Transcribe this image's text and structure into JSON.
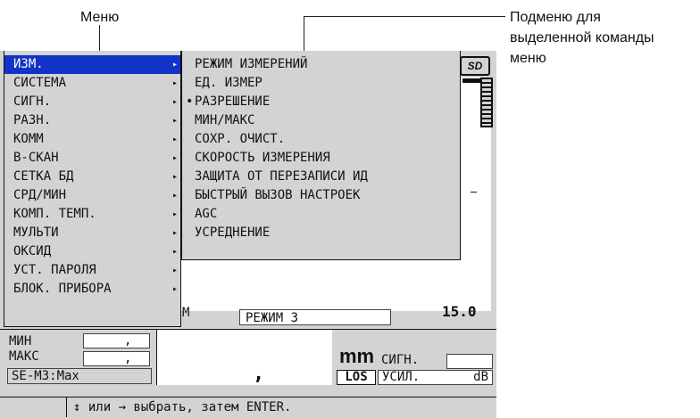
{
  "annotations": {
    "menu_label": "Меню",
    "submenu_label_lines": [
      "Подменю для",
      "выделенной команды",
      "меню"
    ]
  },
  "device": {
    "sd_icon": "SD",
    "menu": [
      {
        "label": "ИЗМ.",
        "selected": true
      },
      {
        "label": "СИСТЕМА"
      },
      {
        "label": "СИГН."
      },
      {
        "label": "РАЗН."
      },
      {
        "label": "КОММ"
      },
      {
        "label": "В-СКАН"
      },
      {
        "label": "СЕТКА БД"
      },
      {
        "label": "СРД/МИН"
      },
      {
        "label": "КОМП. ТЕМП."
      },
      {
        "label": "МУЛЬТИ"
      },
      {
        "label": "ОКСИД"
      },
      {
        "label": "УСТ. ПАРОЛЯ"
      },
      {
        "label": "БЛОК. ПРИБОРА"
      }
    ],
    "submenu": [
      {
        "label": "РЕЖИМ ИЗМЕРЕНИЙ"
      },
      {
        "label": "ЕД. ИЗМЕР"
      },
      {
        "label": "РАЗРЕШЕНИЕ",
        "marked": true
      },
      {
        "label": "МИН/МАКС"
      },
      {
        "label": "СОХР. ОЧИСТ."
      },
      {
        "label": "СКОРОСТЬ ИЗМЕРЕНИЯ"
      },
      {
        "label": "ЗАЩИТА ОТ ПЕРЕЗАПИСИ ИД"
      },
      {
        "label": "БЫСТРЫЙ ВЫЗОВ НАСТРОЕК"
      },
      {
        "label": "AGC"
      },
      {
        "label": "УСРЕДНЕНИЕ"
      }
    ],
    "mode_label": "М",
    "mode_value": "РЕЖИМ 3",
    "velocity_value": "15.0",
    "min_label": "МИН",
    "max_label": "МАКС",
    "min_value": ",",
    "max_value": ",",
    "transducer": "SE-M3:Max",
    "thickness_value": ",",
    "unit": "mm",
    "signal_label": "СИГН.",
    "los_label": "LOS",
    "gain_label": "УСИЛ.",
    "gain_unit": "dB",
    "status_text": "↕ или → выбрать, затем ENTER.",
    "marker_glyph": "•",
    "submenu_arrow_glyph": "▸"
  }
}
